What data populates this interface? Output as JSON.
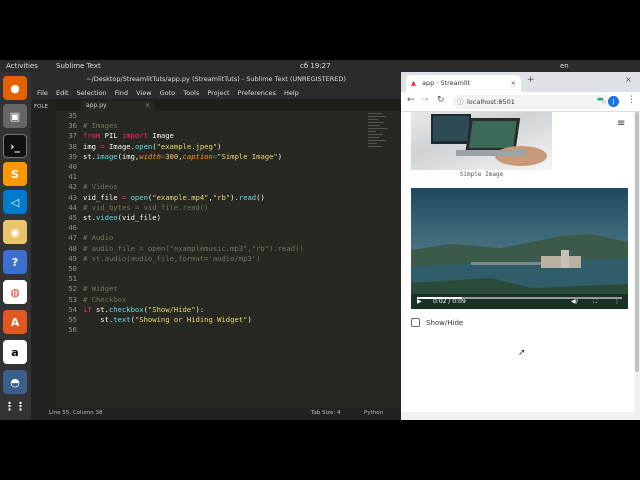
{
  "topbar": {
    "activities": "Activities",
    "app_name": "Sublime Text",
    "clock": "сб 19:27",
    "lang": "en"
  },
  "editor": {
    "title": "~/Desktop/StreamlitTuts/app.py (StreamlitTuts) - Sublime Text (UNREGISTERED)",
    "menu": [
      "File",
      "Edit",
      "Selection",
      "Find",
      "View",
      "Goto",
      "Tools",
      "Project",
      "Preferences",
      "Help"
    ],
    "sidebar_label": "FOLE",
    "tab_label": "app.py",
    "line_numbers": [
      "35",
      "36",
      "37",
      "38",
      "39",
      "40",
      "41",
      "42",
      "43",
      "44",
      "45",
      "46",
      "47",
      "48",
      "49",
      "50",
      "51",
      "52",
      "53",
      "54",
      "55",
      "56"
    ],
    "status_left": "Line 55, Column 38",
    "status_tab": "Tab Size: 4",
    "status_lang": "Python"
  },
  "browser": {
    "tab_title": "app · Streamlit",
    "url": "localhost:8501",
    "avatar_letter": "J",
    "image_caption": "Simple Image",
    "video_time": "0:02 / 0:09",
    "checkbox_label": "Show/Hide"
  },
  "colors": {
    "accent": "#66d9ef",
    "keyword": "#f92672",
    "string": "#e6db74",
    "comment": "#75715e"
  }
}
